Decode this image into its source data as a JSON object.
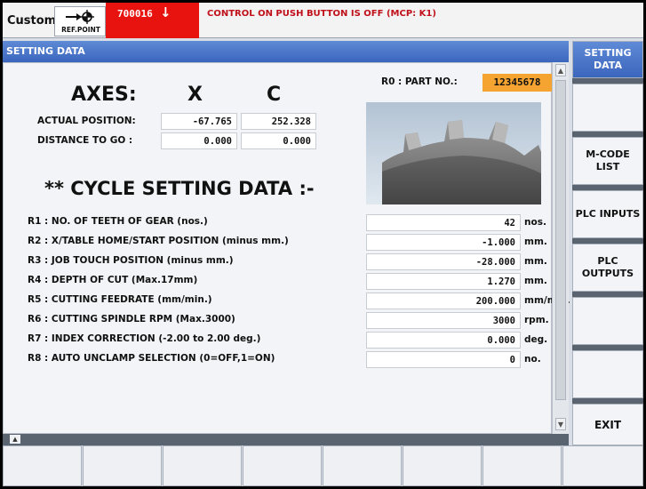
{
  "header": {
    "mode": "Custom",
    "ref_point_label": "REF.POINT",
    "alarm_number": "700016",
    "alarm_arrow": "↓",
    "alarm_message": "CONTROL ON PUSH BUTTON IS OFF (MCP: K1)"
  },
  "title": "SETTING DATA",
  "part": {
    "label": "R0 : PART NO.:",
    "value": "12345678"
  },
  "axes": {
    "heading": "AXES:",
    "columns": [
      "X",
      "C"
    ],
    "rows": [
      {
        "label": "ACTUAL POSITION:",
        "x": "-67.765",
        "c": "252.328"
      },
      {
        "label": "DISTANCE TO GO :",
        "x": "0.000",
        "c": "0.000"
      }
    ]
  },
  "cycle_heading": "** CYCLE SETTING DATA :-",
  "params": [
    {
      "label": "R1 : NO. OF TEETH OF GEAR (nos.)",
      "value": "42",
      "unit": "nos."
    },
    {
      "label": "R2 : X/TABLE HOME/START POSITION (minus mm.)",
      "value": "-1.000",
      "unit": "mm."
    },
    {
      "label": "R3 : JOB TOUCH POSITION (minus mm.)",
      "value": "-28.000",
      "unit": "mm."
    },
    {
      "label": "R4 : DEPTH OF CUT (Max.17mm)",
      "value": "1.270",
      "unit": "mm."
    },
    {
      "label": "R5 : CUTTING FEEDRATE (mm/min.)",
      "value": "200.000",
      "unit": "mm/min."
    },
    {
      "label": "R6 : CUTTING SPINDLE RPM (Max.3000)",
      "value": "3000",
      "unit": "rpm."
    },
    {
      "label": "R7 : INDEX CORRECTION (-2.00 to 2.00 deg.)",
      "value": "0.000",
      "unit": "deg."
    },
    {
      "label": "R8 : AUTO UNCLAMP SELECTION (0=OFF,1=ON)",
      "value": "0",
      "unit": "no."
    }
  ],
  "softkeys_right": {
    "k1": "SETTING DATA",
    "k2": "",
    "k3": "M-CODE LIST",
    "k4": "PLC INPUTS",
    "k5": "PLC OUTPUTS",
    "k6": "",
    "k7": "",
    "k8": "EXIT"
  },
  "icons": {
    "ref_point": "ref-point-icon",
    "scroll_up": "scroll-up-icon",
    "scroll_down": "scroll-down-icon",
    "page_up": "page-up-icon"
  },
  "colors": {
    "alarm": "#e8120e",
    "title": "#3b66bd",
    "part_no": "#f5a431"
  }
}
